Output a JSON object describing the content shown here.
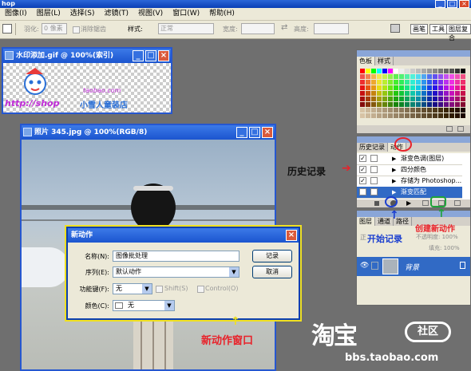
{
  "app": {
    "title": "hop"
  },
  "menu": [
    "图像(I)",
    "图层(L)",
    "选择(S)",
    "滤镜(T)",
    "视图(V)",
    "窗口(W)",
    "帮助(H)"
  ],
  "options": {
    "feather_label": "羽化:",
    "feather_value": "0 像素",
    "antialias_label": "消除锯齿",
    "style_label": "样式:",
    "style_value": "正常",
    "width_label": "宽度:",
    "height_label": "高度:",
    "swap_icon": "⇄",
    "palette_tabs": [
      "画笔",
      "工具",
      "图层复合"
    ]
  },
  "gif_window": {
    "title": "水印添加.gif @ 100%(索引)",
    "watermark_url": "http://shop",
    "watermark_taobao": "taobao.com",
    "watermark_shop": "小雪人童装店"
  },
  "photo_window": {
    "title": "照片 345.jpg @ 100%(RGB/8)"
  },
  "dialog": {
    "title": "新动作",
    "name_label": "名称(N):",
    "name_value": "图像批处理",
    "set_label": "序列(E):",
    "set_value": "默认动作",
    "fkey_label": "功能键(F):",
    "fkey_value": "无",
    "shift_label": "Shift(S)",
    "control_label": "Control(O)",
    "color_label": "颜色(C):",
    "color_value": "无",
    "record_button": "记录",
    "cancel_button": "取消"
  },
  "swatches_panel": {
    "tabs": [
      "色板",
      "样式"
    ]
  },
  "actions_panel": {
    "tabs": [
      "历史记录",
      "动作"
    ],
    "rows": [
      {
        "label": "渐变色调(图层)",
        "checked": true
      },
      {
        "label": "四分颜色",
        "checked": true
      },
      {
        "label": "存储为 Photoshop...",
        "checked": true
      },
      {
        "label": "渐变匹配",
        "checked": true,
        "selected": true
      }
    ]
  },
  "layers_panel": {
    "tabs": [
      "图层",
      "通道",
      "路径"
    ],
    "blend_value": "正",
    "opacity_label": "不透明度: 100%",
    "fill_label": "填充: 100%",
    "layer_name": "背景"
  },
  "annotations": {
    "history": "历史记录",
    "start_record": "开始记录",
    "create_action": "创建新动作",
    "new_action_window": "新动作窗口"
  },
  "watermark": {
    "site": "bbs.taobao.com",
    "brand_big": "淘宝",
    "brand_circle": "社区"
  },
  "colors": {
    "accent_red": "#e8222a",
    "accent_blue": "#1b3fcf",
    "accent_green": "#1fa33a",
    "dialog_highlight": "#f0e020"
  }
}
